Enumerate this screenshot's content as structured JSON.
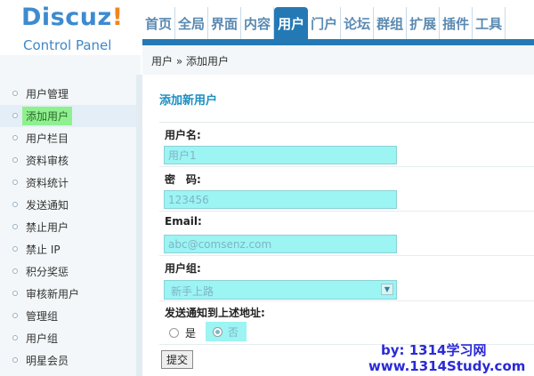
{
  "logo": {
    "word_part1": "Discuz",
    "word_part2": "!",
    "subtitle": "Control Panel"
  },
  "topnav": {
    "items": [
      {
        "label": "首页"
      },
      {
        "label": "全局"
      },
      {
        "label": "界面"
      },
      {
        "label": "内容"
      },
      {
        "label": "用户",
        "active": true
      },
      {
        "label": "门户"
      },
      {
        "label": "论坛"
      },
      {
        "label": "群组"
      },
      {
        "label": "扩展"
      },
      {
        "label": "插件"
      },
      {
        "label": "工具"
      }
    ]
  },
  "breadcrumb": "用户 » 添加用户",
  "sidebar": {
    "items": [
      {
        "label": "用户管理"
      },
      {
        "label": "添加用户",
        "active": true
      },
      {
        "label": "用户栏目"
      },
      {
        "label": "资料审核"
      },
      {
        "label": "资料统计"
      },
      {
        "label": "发送通知"
      },
      {
        "label": "禁止用户"
      },
      {
        "label": "禁止 IP"
      },
      {
        "label": "积分奖惩"
      },
      {
        "label": "审核新用户"
      },
      {
        "label": "管理组"
      },
      {
        "label": "用户组"
      },
      {
        "label": "明星会员"
      }
    ]
  },
  "form": {
    "title": "添加新用户",
    "username": {
      "label": "用户名:",
      "value": "用户1"
    },
    "password": {
      "label": "密　码:",
      "value": "123456"
    },
    "email": {
      "label": "Email:",
      "value": "abc@comsenz.com"
    },
    "usergroup": {
      "label": "用户组:",
      "selected": "新手上路"
    },
    "notify": {
      "label": "发送通知到上述地址:",
      "option_yes": "是",
      "option_no": "否",
      "selected": "否"
    },
    "submit_label": "提交"
  },
  "watermark": {
    "line1": "by: 1314学习网",
    "line2": "www.1314Study.com"
  },
  "colors": {
    "nav_active": "#2479b4",
    "field_highlight": "#9cf4f3",
    "sidebar_highlight": "#8ef08e",
    "title": "#1a8ec1",
    "watermark": "#2a2ad6"
  }
}
